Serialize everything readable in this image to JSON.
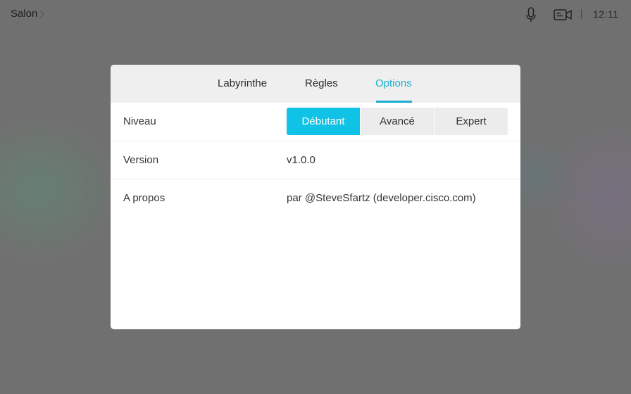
{
  "topbar": {
    "room_name": "Salon",
    "room_chevron_icon": "chevron-right-icon",
    "mic_icon": "microphone-icon",
    "camera_icon": "video-camera-icon",
    "separator": "|",
    "time": "12:11"
  },
  "dialog": {
    "tabs": [
      {
        "label": "Labyrinthe",
        "active": false
      },
      {
        "label": "Règles",
        "active": false
      },
      {
        "label": "Options",
        "active": true
      }
    ],
    "rows": {
      "level": {
        "label": "Niveau",
        "options": [
          "Débutant",
          "Avancé",
          "Expert"
        ],
        "selected": "Débutant"
      },
      "version": {
        "label": "Version",
        "value": "v1.0.0"
      },
      "about": {
        "label": "A propos",
        "value": "par @SteveSfartz (developer.cisco.com)"
      }
    }
  },
  "colors": {
    "accent": "#1aafd0",
    "active_segment": "#10c3e6",
    "backdrop": "#707070"
  }
}
